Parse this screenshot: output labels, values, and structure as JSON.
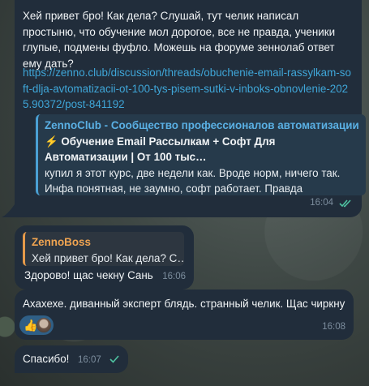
{
  "messages": {
    "m1": {
      "text": "Хей привет бро! Как дела? Слушай, тут челик написал простыню, что обучение мол дорогое, все не правда, ученики глупые, подмены фуфло. Можешь на форуме зеннолаб ответ ему дать?",
      "link": "https://zenno.club/discussion/threads/obuchenie-email-rassylkam-soft-dlja-avtomatizacii-ot-100-tys-pisem-sutki-v-inboks-obnovlenie-2025.90372/post-841192",
      "preview": {
        "site": "ZennoClub - Сообщество профессионалов автоматизации",
        "title": "⚡ Обучение Email Рассылкам + Софт Для Автоматизации | От 100 тыс…",
        "description": "купил я этот курс, две недели как. Вроде норм, ничего так. Инфа понятная, не заумно, софт работает. Правда разбирать…"
      },
      "time": "16:04",
      "status": "read"
    },
    "m2": {
      "reply_author": "ZennoBoss",
      "reply_text": "Хей привет бро! Как дела? С…",
      "text": "Здорово! щас чекну Сань",
      "time": "16:06"
    },
    "m3": {
      "text": "Ахахехе. диванный эксперт блядь. странный челик. Щас чиркну",
      "reaction_emoji": "👍",
      "time": "16:08"
    },
    "m4": {
      "text": "Спасибо!",
      "time": "16:07",
      "status": "sent"
    }
  },
  "colors": {
    "bubble": "#212d3b",
    "link": "#3fa6d8",
    "reply_accent": "#e59a4a",
    "read_check": "#4fc3a1"
  }
}
